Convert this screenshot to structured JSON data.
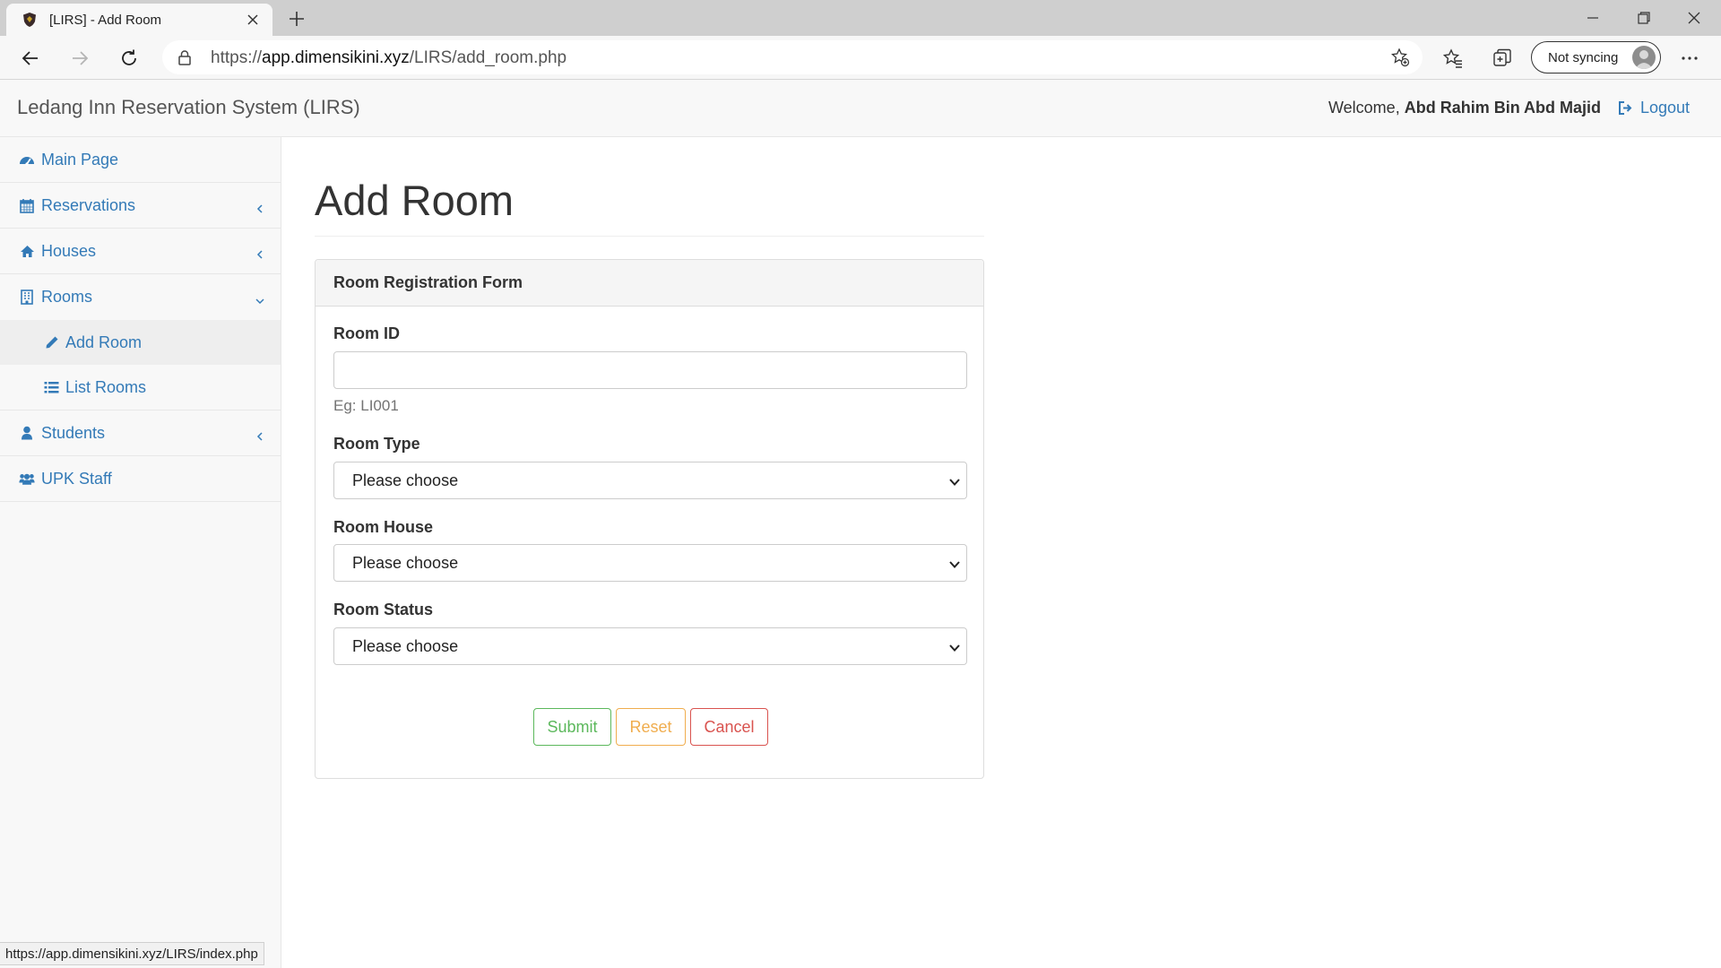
{
  "browser": {
    "tab_title": "[LIRS] - Add Room",
    "url_prefix": "https://",
    "url_host": "app.dimensikini.xyz",
    "url_path": "/LIRS/add_room.php",
    "sync_label": "Not syncing",
    "status_url": "https://app.dimensikini.xyz/LIRS/index.php",
    "icons": [
      "shield-favicon-icon",
      "close-icon",
      "plus-icon",
      "minimize-icon",
      "restore-icon",
      "close-window-icon",
      "back-arrow-icon",
      "forward-arrow-icon",
      "refresh-icon",
      "lock-icon",
      "add-favorite-icon",
      "favorites-icon",
      "collections-icon",
      "profile-icon",
      "more-icon"
    ]
  },
  "header": {
    "brand": "Ledang Inn Reservation System (LIRS)",
    "welcome_prefix": "Welcome,",
    "user_name": "Abd Rahim Bin Abd Majid",
    "logout_label": "Logout"
  },
  "sidebar": {
    "items": [
      {
        "label": "Main Page",
        "icon": "dashboard-icon"
      },
      {
        "label": "Reservations",
        "icon": "calendar-icon"
      },
      {
        "label": "Houses",
        "icon": "home-icon"
      },
      {
        "label": "Rooms",
        "icon": "building-icon"
      },
      {
        "label": "Students",
        "icon": "user-icon"
      },
      {
        "label": "UPK Staff",
        "icon": "users-icon"
      }
    ],
    "rooms_sub": [
      {
        "label": "Add Room",
        "icon": "pencil-icon",
        "active": true
      },
      {
        "label": "List Rooms",
        "icon": "list-icon",
        "active": false
      }
    ]
  },
  "main": {
    "page_title": "Add Room",
    "panel_heading": "Room Registration Form",
    "fields": {
      "room_id_label": "Room ID",
      "room_id_value": "",
      "room_id_help": "Eg: LI001",
      "room_type_label": "Room Type",
      "room_type_value": "Please choose",
      "room_house_label": "Room House",
      "room_house_value": "Please choose",
      "room_status_label": "Room Status",
      "room_status_value": "Please choose"
    },
    "buttons": {
      "submit": "Submit",
      "reset": "Reset",
      "cancel": "Cancel"
    }
  },
  "colors": {
    "link": "#337ab7",
    "success": "#5cb85c",
    "warning": "#f0ad4e",
    "danger": "#d9534f"
  }
}
